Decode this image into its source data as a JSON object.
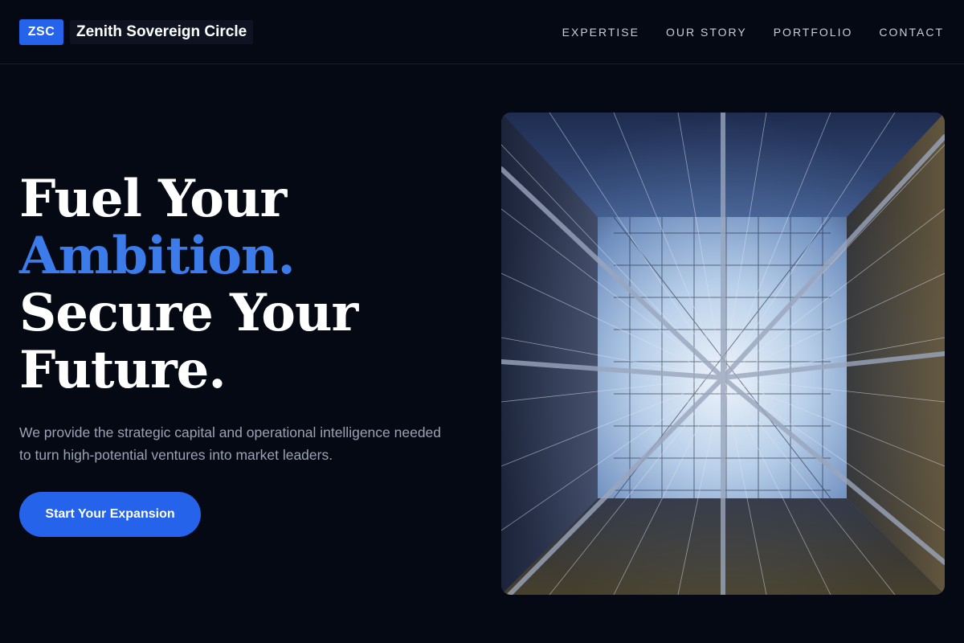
{
  "brand": {
    "badge": "ZSC",
    "name": "Zenith Sovereign Circle"
  },
  "nav": [
    {
      "label": "EXPERTISE"
    },
    {
      "label": "OUR STORY"
    },
    {
      "label": "PORTFOLIO"
    },
    {
      "label": "CONTACT"
    }
  ],
  "hero": {
    "title_line1": "Fuel Your",
    "title_line2": "Ambition.",
    "title_line3": "Secure Your",
    "title_line4": "Future.",
    "subtitle": "We provide the strategic capital and operational intelligence needed to turn high-potential ventures into market leaders.",
    "cta_label": "Start Your Expansion"
  },
  "colors": {
    "background": "#050914",
    "accent": "#2563eb",
    "accent_text": "#3b7bea"
  },
  "image": {
    "subject": "architectural atrium looking up at glass skylight"
  }
}
